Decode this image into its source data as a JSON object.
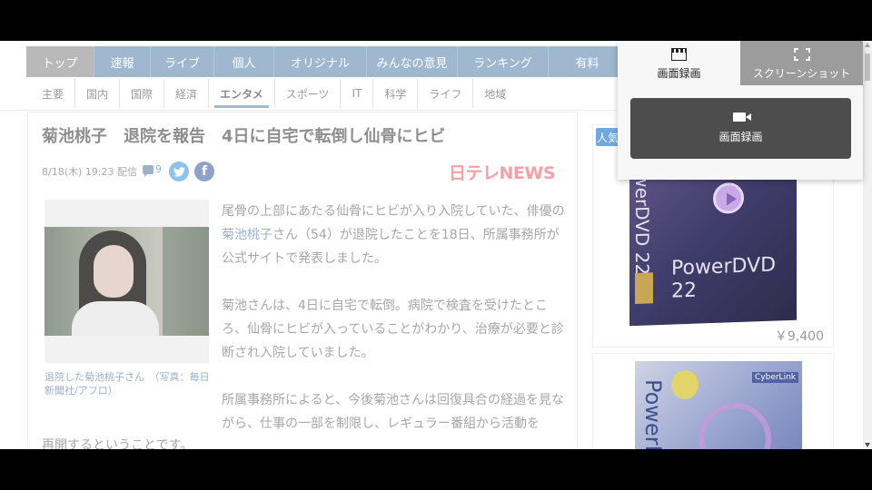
{
  "nav": {
    "items": [
      {
        "label": "トップ",
        "active": true
      },
      {
        "label": "速報"
      },
      {
        "label": "ライブ"
      },
      {
        "label": "個人"
      },
      {
        "label": "オリジナル"
      },
      {
        "label": "みんなの意見"
      },
      {
        "label": "ランキング"
      },
      {
        "label": "有料"
      }
    ]
  },
  "subnav": {
    "items": [
      {
        "label": "主要"
      },
      {
        "label": "国内"
      },
      {
        "label": "国際"
      },
      {
        "label": "経済"
      },
      {
        "label": "エンタメ",
        "active": true
      },
      {
        "label": "スポーツ"
      },
      {
        "label": "IT"
      },
      {
        "label": "科学"
      },
      {
        "label": "ライフ"
      },
      {
        "label": "地域"
      }
    ]
  },
  "article": {
    "title": "菊池桃子　退院を報告　4日に自宅で転倒し仙骨にヒビ",
    "meta": "8/18(木) 19:23 配信",
    "comment_count": "9",
    "source_logo": "日テレNEWS",
    "caption": "退院した菊池桃子さん　（写真：毎日新聞社/アフロ）",
    "p1_before": "尾骨の上部にあたる仙骨にヒビが入り入院していた、俳優の",
    "p1_link": "菊池桃子",
    "p1_after": "さん（54）が退院したことを18日、所属事務所が公式サイトで発表しました。",
    "p2": "菊池さんは、4日に自宅で転倒。病院で検査を受けたところ、仙骨にヒビが入っていることがわかり、治療が必要と診断され入院していました。",
    "p3": "所属事務所によると、今後菊池さんは回復具合の経過を見ながら、仕事の一部を制限し、レギュラー番組から活動を",
    "p3_tail": "再開するということです。"
  },
  "sidebar": {
    "badge": "人気",
    "product1": {
      "brand": "PowerDVD 22",
      "vertical": "PowerDVD 22",
      "price": "￥9,400"
    },
    "product2": {
      "vertical": "PowerD",
      "tag": "CyberLink"
    }
  },
  "popup": {
    "tab_record": "画面録画",
    "tab_screenshot": "スクリーンショット",
    "record_button": "画面録画"
  },
  "colors": {
    "nav_bg": "#9fb7cf",
    "active_tab": "#b9b9b9",
    "popup_button": "#4d4d4d",
    "link": "#9db0c8"
  },
  "icons": [
    "clapperboard-icon",
    "screenshot-corners-icon",
    "video-camera-icon",
    "twitter-icon",
    "facebook-icon",
    "comment-icon"
  ]
}
